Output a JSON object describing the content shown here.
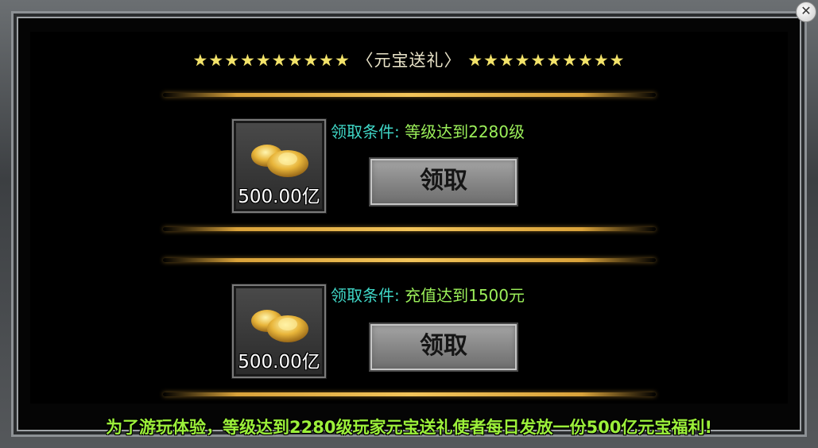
{
  "header": {
    "stars_left": "★★★★★★★★★★",
    "title": "〈元宝送礼〉",
    "stars_right": "★★★★★★★★★★"
  },
  "rewards": [
    {
      "amount": "500.00亿",
      "condition_label": "领取条件:",
      "condition_value": "等级达到2280级",
      "button_label": "领取",
      "icon": "gold-ingot-icon"
    },
    {
      "amount": "500.00亿",
      "condition_label": "领取条件:",
      "condition_value": "充值达到1500元",
      "button_label": "领取",
      "icon": "gold-ingot-icon"
    }
  ],
  "footer": {
    "text": "为了游玩体验，等级达到2280级玩家元宝送礼使者每日发放一份500亿元宝福利!"
  },
  "colors": {
    "star": "#f3e36a",
    "condition_label": "#3fd6c6",
    "condition_value": "#9cf05a",
    "footer": "#9cf03a",
    "divider": "#f2c45a"
  }
}
